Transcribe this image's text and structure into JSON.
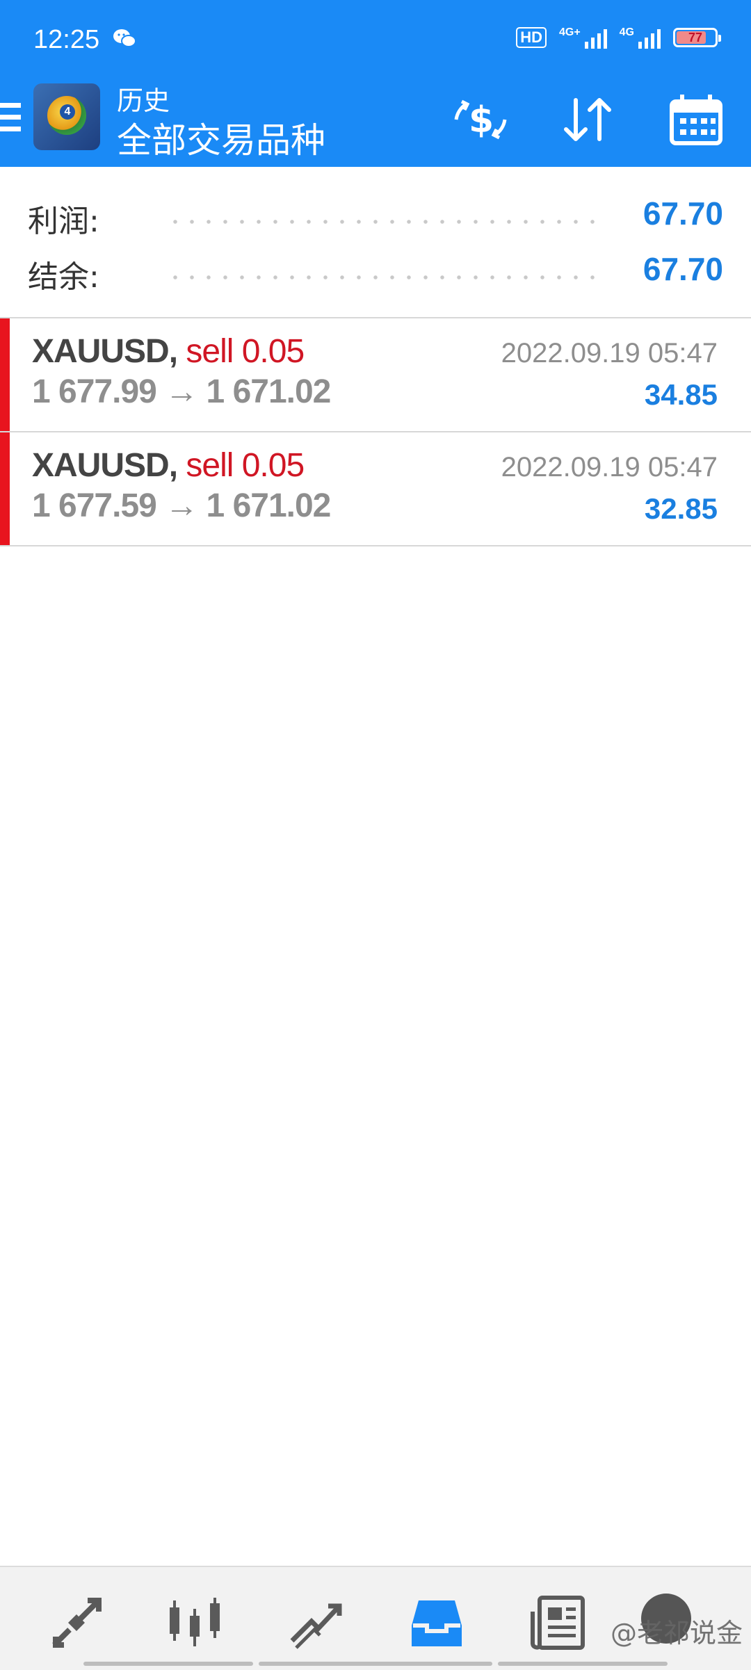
{
  "status_bar": {
    "time": "12:25",
    "hd_label": "HD",
    "signal1_label": "4G+",
    "signal2_label": "4G",
    "battery_level": "77",
    "battery_fraction": 0.77
  },
  "app_bar": {
    "subtitle": "历史",
    "title": "全部交易品种",
    "accent_color": "#1a8af6"
  },
  "summary": {
    "profit_label": "利润:",
    "profit_value": "67.70",
    "balance_label": "结余:",
    "balance_value": "67.70"
  },
  "deals": [
    {
      "symbol": "XAUUSD,",
      "side": "sell 0.05",
      "open_price": "1 677.99",
      "arrow": "→",
      "close_price": "1 671.02",
      "time": "2022.09.19 05:47",
      "profit": "34.85"
    },
    {
      "symbol": "XAUUSD,",
      "side": "sell 0.05",
      "open_price": "1 677.59",
      "arrow": "→",
      "close_price": "1 671.02",
      "time": "2022.09.19 05:47",
      "profit": "32.85"
    }
  ],
  "bottom_nav": {
    "items": [
      "quotes-icon",
      "chart-icon",
      "trade-icon",
      "history-icon",
      "news-icon",
      "chat-icon"
    ],
    "active": "history-icon",
    "watermark": "@老祁说金"
  },
  "colors": {
    "sell": "#d01624",
    "profit": "#1a7fe0",
    "bar": "#e8141e"
  }
}
